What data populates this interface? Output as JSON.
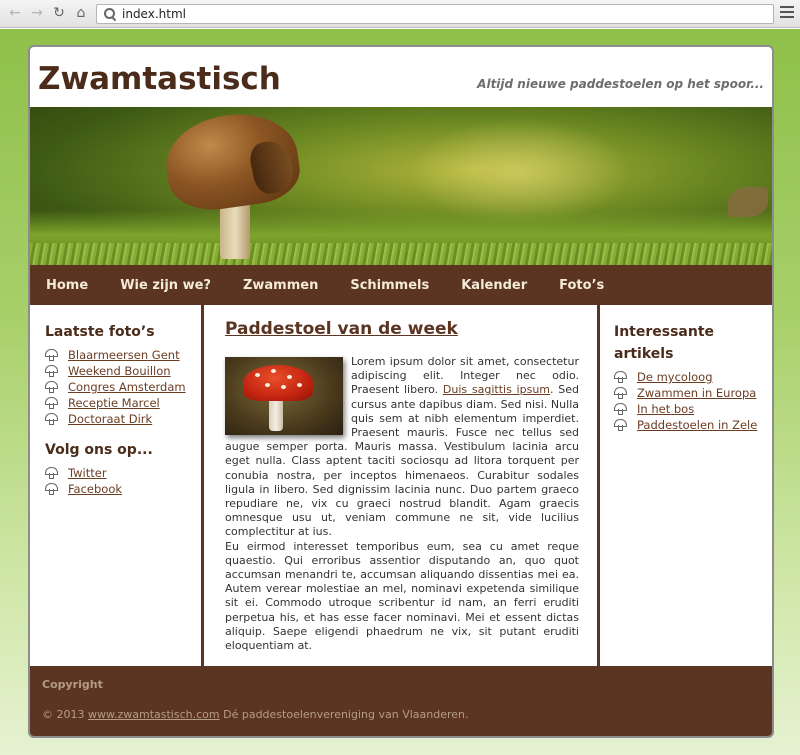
{
  "browser": {
    "url": "index.html"
  },
  "site": {
    "title": "Zwamtastisch",
    "tagline": "Altijd nieuwe paddestoelen op het spoor..."
  },
  "nav": {
    "items": [
      "Home",
      "Wie zijn we?",
      "Zwammen",
      "Schimmels",
      "Kalender",
      "Foto’s"
    ]
  },
  "left": {
    "photos_heading": "Laatste foto’s",
    "photos": [
      "Blaarmeersen Gent",
      "Weekend Bouillon",
      "Congres Amsterdam",
      "Receptie Marcel",
      "Doctoraat Dirk"
    ],
    "follow_heading": "Volg ons op...",
    "follow": [
      "Twitter",
      "Facebook"
    ]
  },
  "main": {
    "title": "Paddestoel van de week",
    "p1_a": "Lorem ipsum dolor sit amet, consectetur adipiscing elit. Integer nec odio. Praesent libero. ",
    "p1_link": "Duis sagittis ipsum",
    "p1_b": ". Sed cursus ante dapibus diam. Sed nisi. Nulla quis sem at nibh elementum imperdiet. Praesent mauris. Fusce nec tellus sed augue semper porta. Mauris massa. Vestibulum lacinia arcu eget nulla. Class aptent taciti sociosqu ad litora torquent per conubia nostra, per inceptos himenaeos. Curabitur sodales ligula in libero. Sed dignissim lacinia nunc. Duo partem graeco repudiare ne, vix cu graeci nostrud blandit. Agam graecis omnesque usu ut, veniam commune ne sit, vide lucilius complectitur at ius.",
    "p2": "Eu eirmod interesset temporibus eum, sea cu amet reque quaestio. Qui erroribus assentior disputando an, quo quot accumsan menandri te, accumsan aliquando dissentias mei ea. Autem verear molestiae an mel, nominavi expetenda similique sit ei. Commodo utroque scribentur id nam, an ferri eruditi perpetua his, et has esse facer nominavi. Mei et essent dictas aliquip. Saepe eligendi phaedrum ne vix, sit putant eruditi eloquentiam at."
  },
  "right": {
    "heading": "Interessante artikels",
    "articles": [
      "De mycoloog",
      "Zwammen in Europa",
      "In het bos",
      "Paddestoelen in Zele"
    ]
  },
  "footer": {
    "heading": "Copyright",
    "copy_prefix": "© 2013 ",
    "link": "www.zwamtastisch.com",
    "copy_suffix": " Dé paddestoelenvereniging van Vlaanderen."
  },
  "colors": {
    "brand_brown": "#5c3422",
    "title_brown": "#4b2c1b",
    "background_green": "#8fc04a"
  }
}
